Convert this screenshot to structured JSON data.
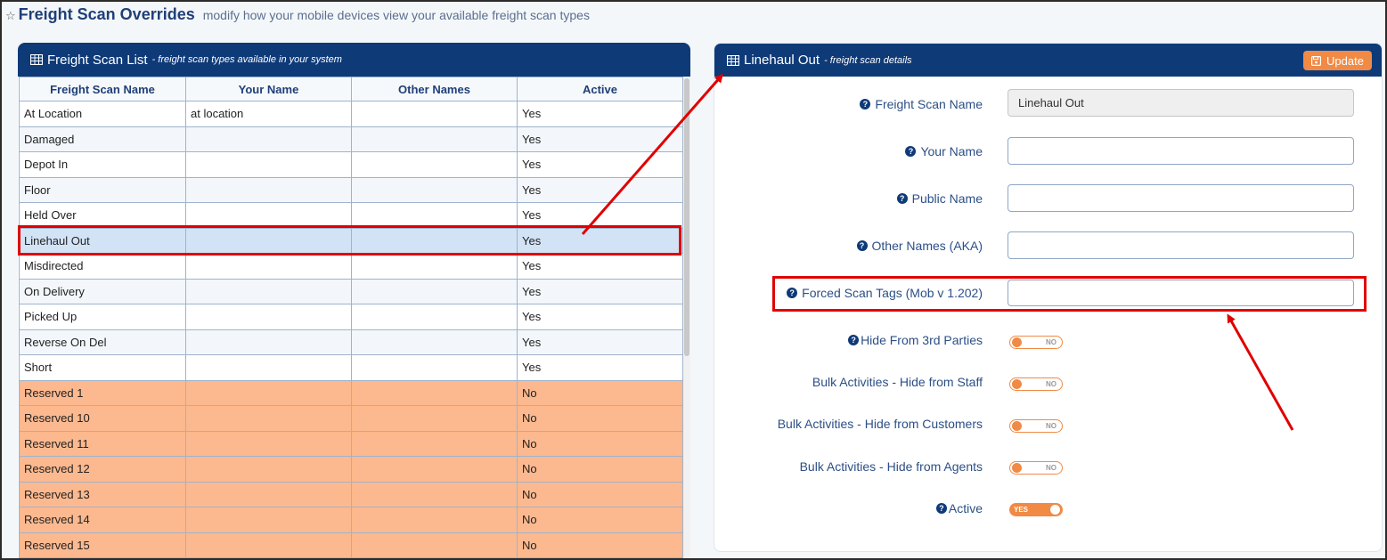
{
  "page": {
    "title": "Freight Scan Overrides",
    "subtitle": "modify how your mobile devices view your available freight scan types"
  },
  "list_panel": {
    "title": "Freight Scan List",
    "subtitle": "- freight scan types available in your system",
    "columns": [
      "Freight Scan Name",
      "Your Name",
      "Other Names",
      "Active"
    ],
    "rows": [
      {
        "name": "At Location",
        "your_name": "at location",
        "other_names": "",
        "active": "Yes"
      },
      {
        "name": "Damaged",
        "your_name": "",
        "other_names": "",
        "active": "Yes"
      },
      {
        "name": "Depot In",
        "your_name": "",
        "other_names": "",
        "active": "Yes"
      },
      {
        "name": "Floor",
        "your_name": "",
        "other_names": "",
        "active": "Yes"
      },
      {
        "name": "Held Over",
        "your_name": "",
        "other_names": "",
        "active": "Yes"
      },
      {
        "name": "Linehaul Out",
        "your_name": "",
        "other_names": "",
        "active": "Yes",
        "selected": true
      },
      {
        "name": "Misdirected",
        "your_name": "",
        "other_names": "",
        "active": "Yes"
      },
      {
        "name": "On Delivery",
        "your_name": "",
        "other_names": "",
        "active": "Yes"
      },
      {
        "name": "Picked Up",
        "your_name": "",
        "other_names": "",
        "active": "Yes"
      },
      {
        "name": "Reverse On Del",
        "your_name": "",
        "other_names": "",
        "active": "Yes"
      },
      {
        "name": "Short",
        "your_name": "",
        "other_names": "",
        "active": "Yes"
      },
      {
        "name": "Reserved 1",
        "your_name": "",
        "other_names": "",
        "active": "No"
      },
      {
        "name": "Reserved 10",
        "your_name": "",
        "other_names": "",
        "active": "No"
      },
      {
        "name": "Reserved 11",
        "your_name": "",
        "other_names": "",
        "active": "No"
      },
      {
        "name": "Reserved 12",
        "your_name": "",
        "other_names": "",
        "active": "No"
      },
      {
        "name": "Reserved 13",
        "your_name": "",
        "other_names": "",
        "active": "No"
      },
      {
        "name": "Reserved 14",
        "your_name": "",
        "other_names": "",
        "active": "No"
      },
      {
        "name": "Reserved 15",
        "your_name": "",
        "other_names": "",
        "active": "No"
      },
      {
        "name": "",
        "your_name": "",
        "other_names": "",
        "active": ""
      }
    ]
  },
  "detail_panel": {
    "title": "Linehaul Out",
    "subtitle": "- freight scan details",
    "update_label": "Update",
    "fields": {
      "freight_scan_name": {
        "label": "Freight Scan Name",
        "value": "Linehaul Out"
      },
      "your_name": {
        "label": "Your Name",
        "value": ""
      },
      "public_name": {
        "label": "Public Name",
        "value": ""
      },
      "other_names": {
        "label": "Other Names (AKA)",
        "value": ""
      },
      "forced_scan_tags": {
        "label": "Forced Scan Tags (Mob v 1.202)",
        "value": ""
      }
    },
    "toggles": {
      "hide_3rd_parties": {
        "label": "Hide From 3rd Parties",
        "state": "NO"
      },
      "bulk_hide_staff": {
        "label": "Bulk Activities - Hide from Staff",
        "state": "NO"
      },
      "bulk_hide_customers": {
        "label": "Bulk Activities - Hide from Customers",
        "state": "NO"
      },
      "bulk_hide_agents": {
        "label": "Bulk Activities - Hide from Agents",
        "state": "NO"
      },
      "active": {
        "label": "Active",
        "state": "YES"
      }
    }
  },
  "icons": {
    "header": "star-icon",
    "panel": "table-grid-icon",
    "update": "save-icon",
    "help": "question-circle-icon"
  },
  "colors": {
    "panel_header": "#0e3a78",
    "accent": "#f08a45",
    "reserved_row": "#fcb98f",
    "selected_row": "#d3e3f6",
    "annotation": "#e00000"
  }
}
